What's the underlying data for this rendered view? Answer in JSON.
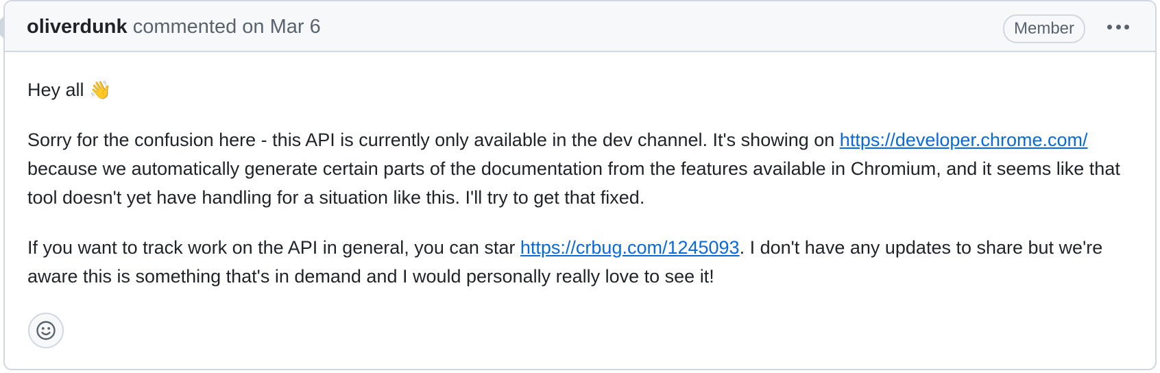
{
  "comment": {
    "author": "oliverdunk",
    "action": "commented on Mar 6",
    "role_badge": "Member",
    "more_icon": "kebab-horizontal-icon",
    "reaction_icon": "smiley-icon",
    "greeting": "Hey all",
    "greeting_emoji": "👋",
    "paragraph_2": {
      "text_1": "Sorry for the confusion here - this API is currently only available in the dev channel. It's showing on ",
      "link": "https://developer.chrome.com/",
      "text_2": " because we automatically generate certain parts of the documentation from the features available in Chromium, and it seems like that tool doesn't yet have handling for a situation like this. I'll try to get that fixed."
    },
    "paragraph_3": {
      "text_1": "If you want to track work on the API in general, you can star ",
      "link": "https://crbug.com/1245093",
      "text_2": ". I don't have any updates to share but we're aware this is something that's in demand and I would personally really love to see it!"
    }
  },
  "colors": {
    "link": "#0969da",
    "border": "#d0d7de",
    "header_bg": "#f6f8fa",
    "muted_text": "#59636e"
  }
}
